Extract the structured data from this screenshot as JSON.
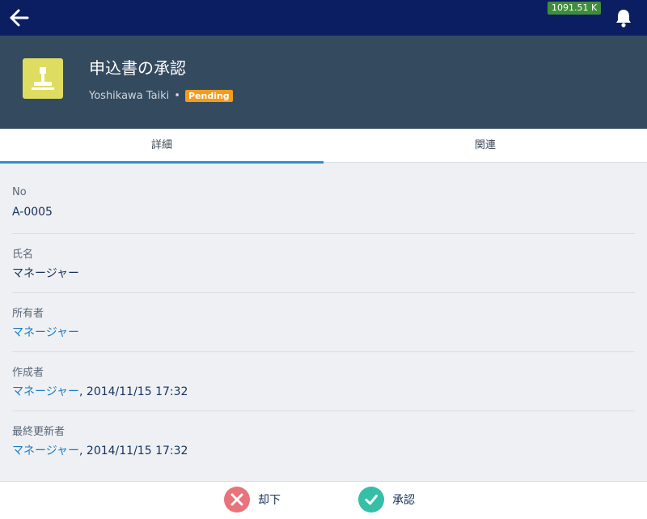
{
  "topbar": {
    "back_icon": "back-arrow-icon",
    "memory_badge": "1091.51 K",
    "bell_icon": "bell-icon"
  },
  "record": {
    "icon": "stamp-icon",
    "title": "申込書の承認",
    "owner": "Yoshikawa Taiki",
    "separator": "•",
    "status": "Pending"
  },
  "tabs": [
    {
      "label": "詳細",
      "active": true
    },
    {
      "label": "関連",
      "active": false
    }
  ],
  "fields": {
    "no": {
      "label": "No",
      "value": "A-0005"
    },
    "name": {
      "label": "氏名",
      "value": "マネージャー"
    },
    "owner": {
      "label": "所有者",
      "value": "マネージャー"
    },
    "created_by": {
      "label": "作成者",
      "user": "マネージャー",
      "date": ", 2014/11/15 17:32"
    },
    "modified_by": {
      "label": "最終更新者",
      "user": "マネージャー",
      "date": ", 2014/11/15 17:32"
    }
  },
  "actions": {
    "reject": {
      "label": "却下",
      "icon": "close-icon",
      "color": "#e8737a"
    },
    "approve": {
      "label": "承認",
      "icon": "check-icon",
      "color": "#34bfa6"
    }
  }
}
